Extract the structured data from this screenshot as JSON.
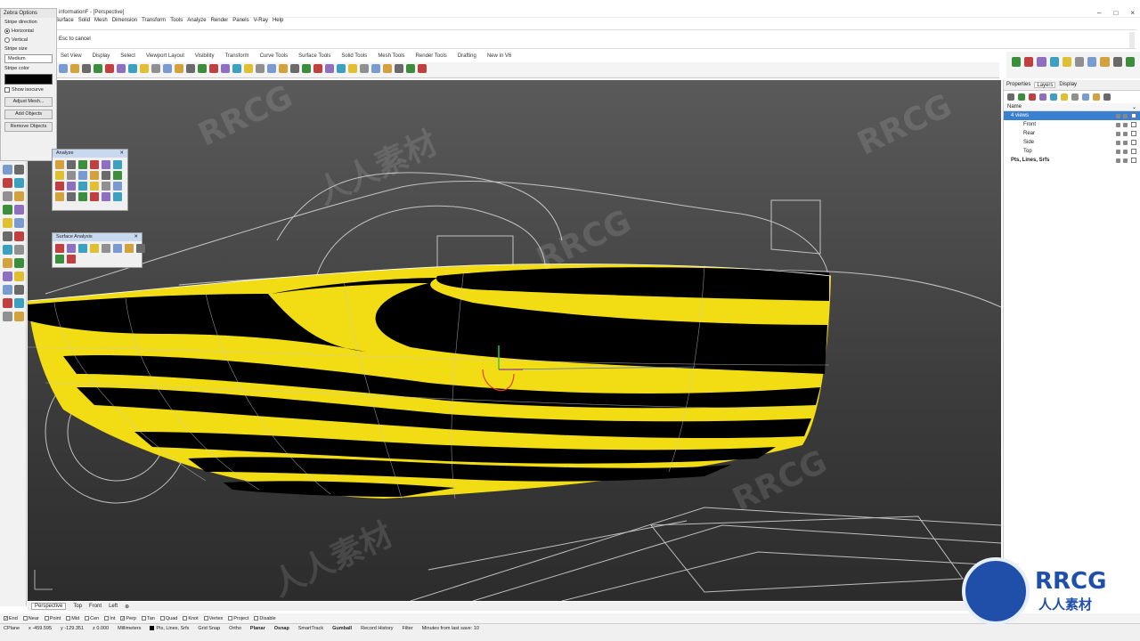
{
  "window": {
    "title": "informationF - [Perspective]",
    "controls": [
      "–",
      "□",
      "×"
    ]
  },
  "menu": [
    "Surface",
    "Solid",
    "Mesh",
    "Dimension",
    "Transform",
    "Tools",
    "Analyze",
    "Render",
    "Panels",
    "V-Ray",
    "Help"
  ],
  "command": {
    "prompt": "Esc to cancel"
  },
  "toolbar_tabs": [
    "Set View",
    "Display",
    "Select",
    "Viewport Layout",
    "Visibility",
    "Transform",
    "Curve Tools",
    "Surface Tools",
    "Solid Tools",
    "Mesh Tools",
    "Render Tools",
    "Drafting",
    "New in V6"
  ],
  "zebra_options": {
    "title": "Zebra Options",
    "stripe_direction_label": "Stripe direction",
    "horizontal": "Horizontal",
    "vertical": "Vertical",
    "stripe_size_label": "Stripe size",
    "stripe_size_value": "Medium",
    "stripe_color_label": "Stripe color",
    "stripe_color": "#000000",
    "show_isocurve": "Show isocurve",
    "adjust_mesh": "Adjust Mesh...",
    "add_objects": "Add Objects",
    "remove_objects": "Remove Objects"
  },
  "analyze_panel": {
    "title": "Analyze"
  },
  "surface_analysis_panel": {
    "title": "Surface Analysis"
  },
  "viewport": {
    "stripe_yellow": "#f2dc14",
    "stripe_black": "#000000"
  },
  "viewport_tabs": [
    "Perspective",
    "Top",
    "Front",
    "Left"
  ],
  "osnaps": [
    {
      "label": "End",
      "on": true
    },
    {
      "label": "Near",
      "on": false
    },
    {
      "label": "Point",
      "on": false
    },
    {
      "label": "Mid",
      "on": false
    },
    {
      "label": "Cen",
      "on": false
    },
    {
      "label": "Int",
      "on": false
    },
    {
      "label": "Perp",
      "on": true
    },
    {
      "label": "Tan",
      "on": false
    },
    {
      "label": "Quad",
      "on": false
    },
    {
      "label": "Knot",
      "on": false
    },
    {
      "label": "Vertex",
      "on": false
    },
    {
      "label": "Project",
      "on": false
    },
    {
      "label": "Disable",
      "on": false
    }
  ],
  "status": {
    "cplane": "CPlane",
    "x": "x -459.595",
    "y": "y -129.351",
    "z": "z 0.000",
    "units": "Millimeters",
    "layer": "Pts, Lines, Srfs",
    "grid_snap": "Grid Snap",
    "ortho": "Ortho",
    "planar": "Planar",
    "osnap": "Osnap",
    "smarttrack": "SmartTrack",
    "gumball": "Gumball",
    "record_history": "Record History",
    "filter": "Filter",
    "last_save": "Minutes from last save: 10"
  },
  "right_panel": {
    "tabs": [
      "Properties",
      "Layers",
      "Display"
    ],
    "column_name": "Name",
    "layers": [
      {
        "name": "4 views",
        "selected": true,
        "indent": 0
      },
      {
        "name": "Front",
        "selected": false,
        "indent": 1
      },
      {
        "name": "Rear",
        "selected": false,
        "indent": 1
      },
      {
        "name": "Side",
        "selected": false,
        "indent": 1
      },
      {
        "name": "Top",
        "selected": false,
        "indent": 1
      },
      {
        "name": "Pts, Lines, Srfs",
        "selected": false,
        "indent": 0
      }
    ]
  },
  "branding": {
    "logo_text": "RRCG",
    "logo_sub": "人人素材",
    "watermark": "人人素材",
    "watermark2": "RRCG"
  }
}
